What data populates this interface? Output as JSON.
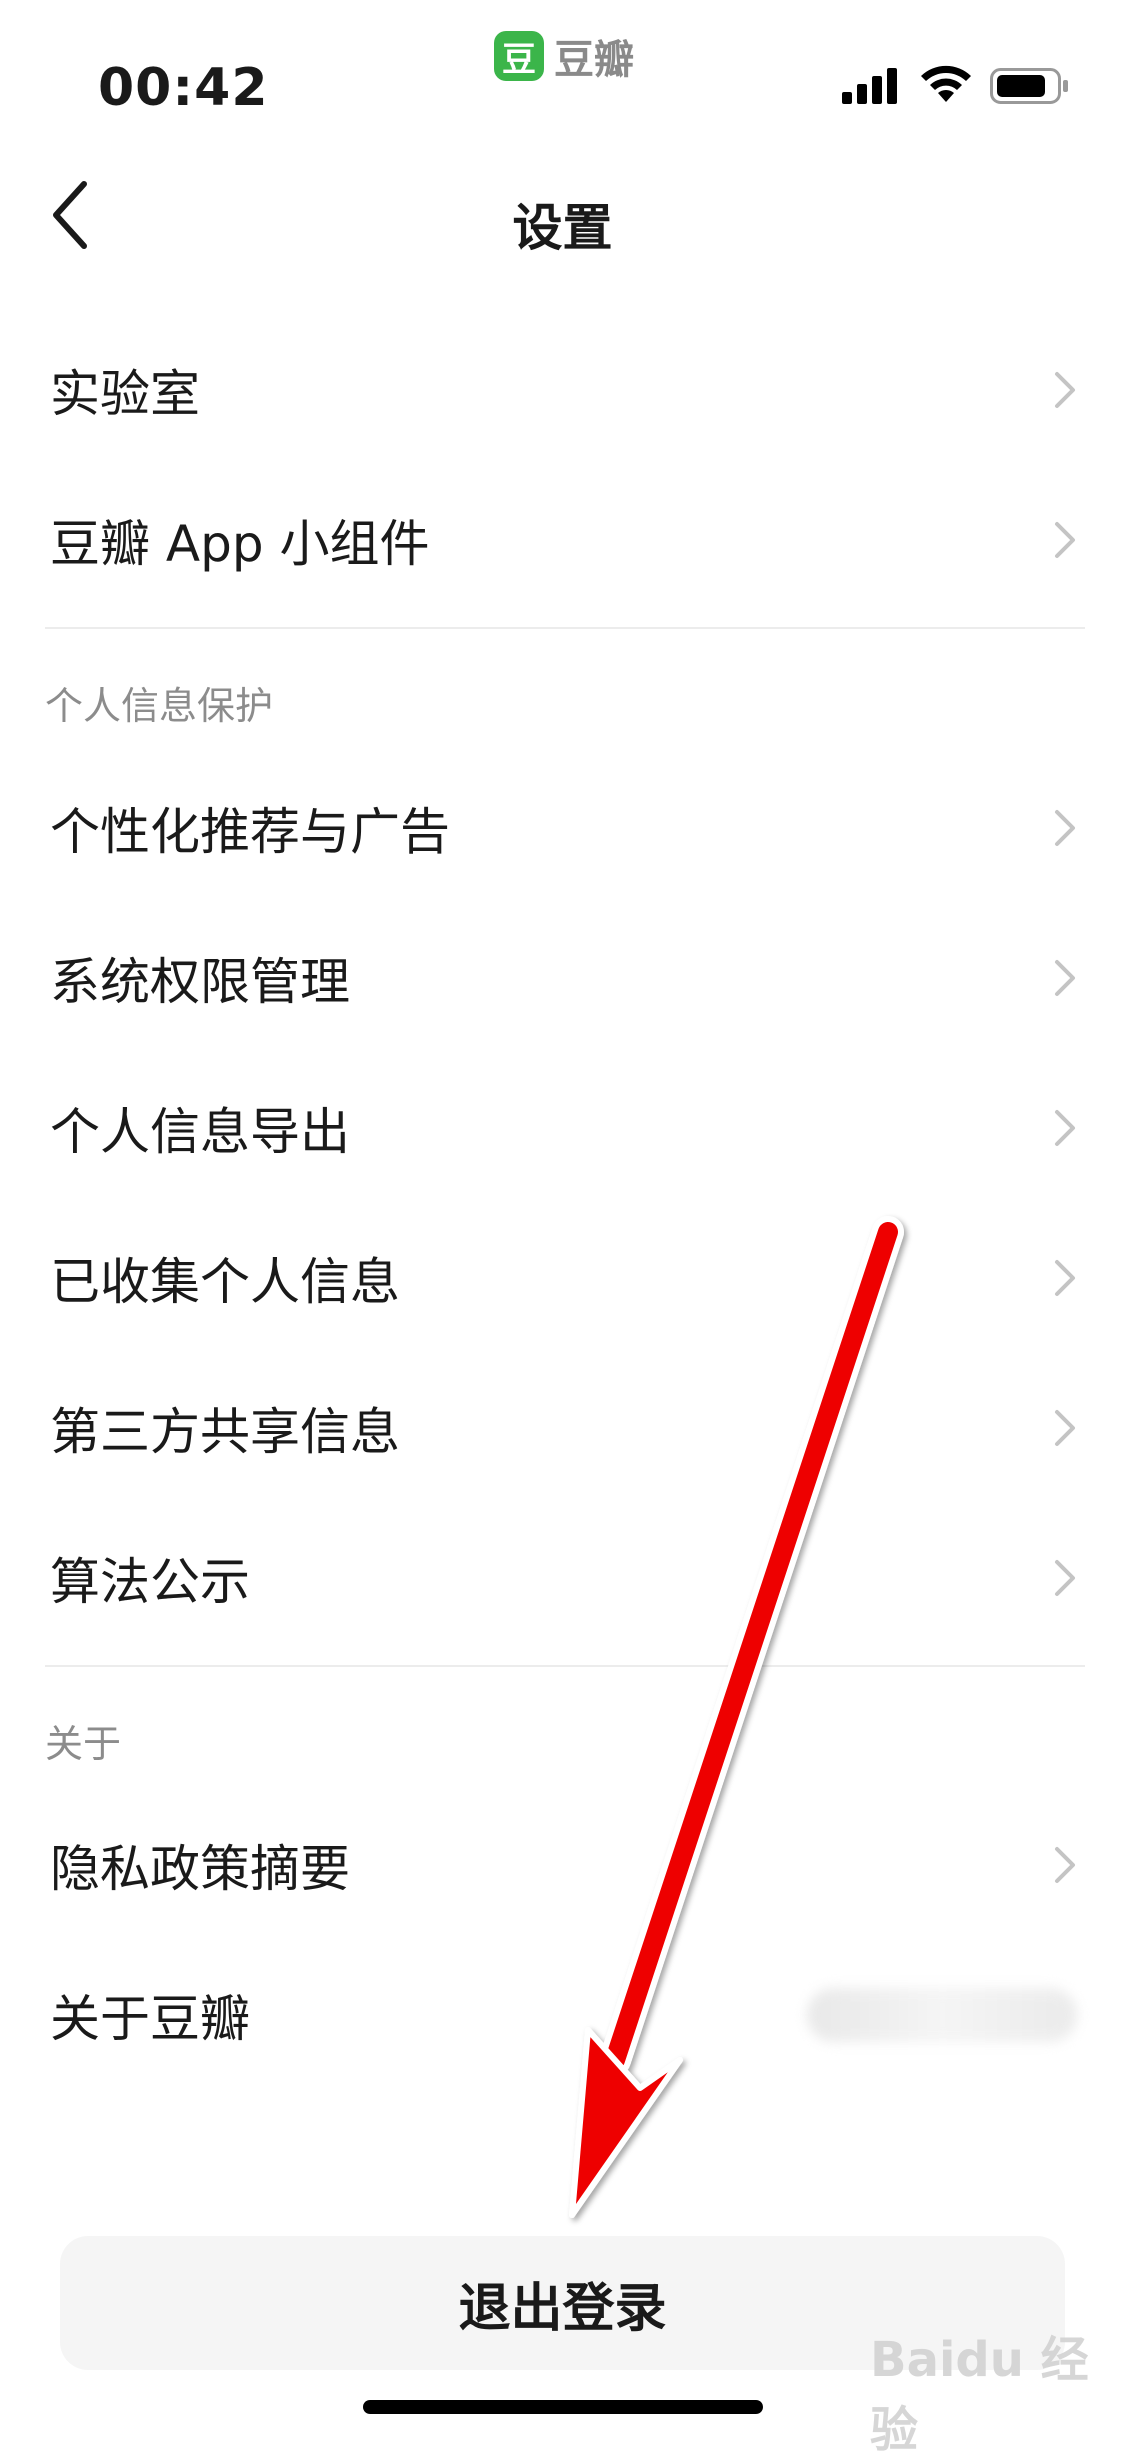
{
  "status_bar": {
    "time": "00:42",
    "app_logo_glyph": "豆",
    "app_name": "豆瓣"
  },
  "nav": {
    "title": "设置",
    "back_icon": "chevron-left-icon"
  },
  "items_top": [
    {
      "label": "实验室"
    },
    {
      "label": "豆瓣 App 小组件"
    }
  ],
  "sections": {
    "privacy_header": "个人信息保护",
    "about_header": "关于"
  },
  "privacy_items": [
    {
      "label": "个性化推荐与广告"
    },
    {
      "label": "系统权限管理"
    },
    {
      "label": "个人信息导出"
    },
    {
      "label": "已收集个人信息"
    },
    {
      "label": "第三方共享信息"
    },
    {
      "label": "算法公示"
    }
  ],
  "about_items": [
    {
      "label": "隐私政策摘要"
    },
    {
      "label": "关于豆瓣"
    }
  ],
  "logout_label": "退出登录",
  "watermark_text": "Baidu 经验",
  "colors": {
    "brand_green": "#3bb54a",
    "annotation_arrow": "#ee0000",
    "section_header": "#8c8c8c"
  }
}
